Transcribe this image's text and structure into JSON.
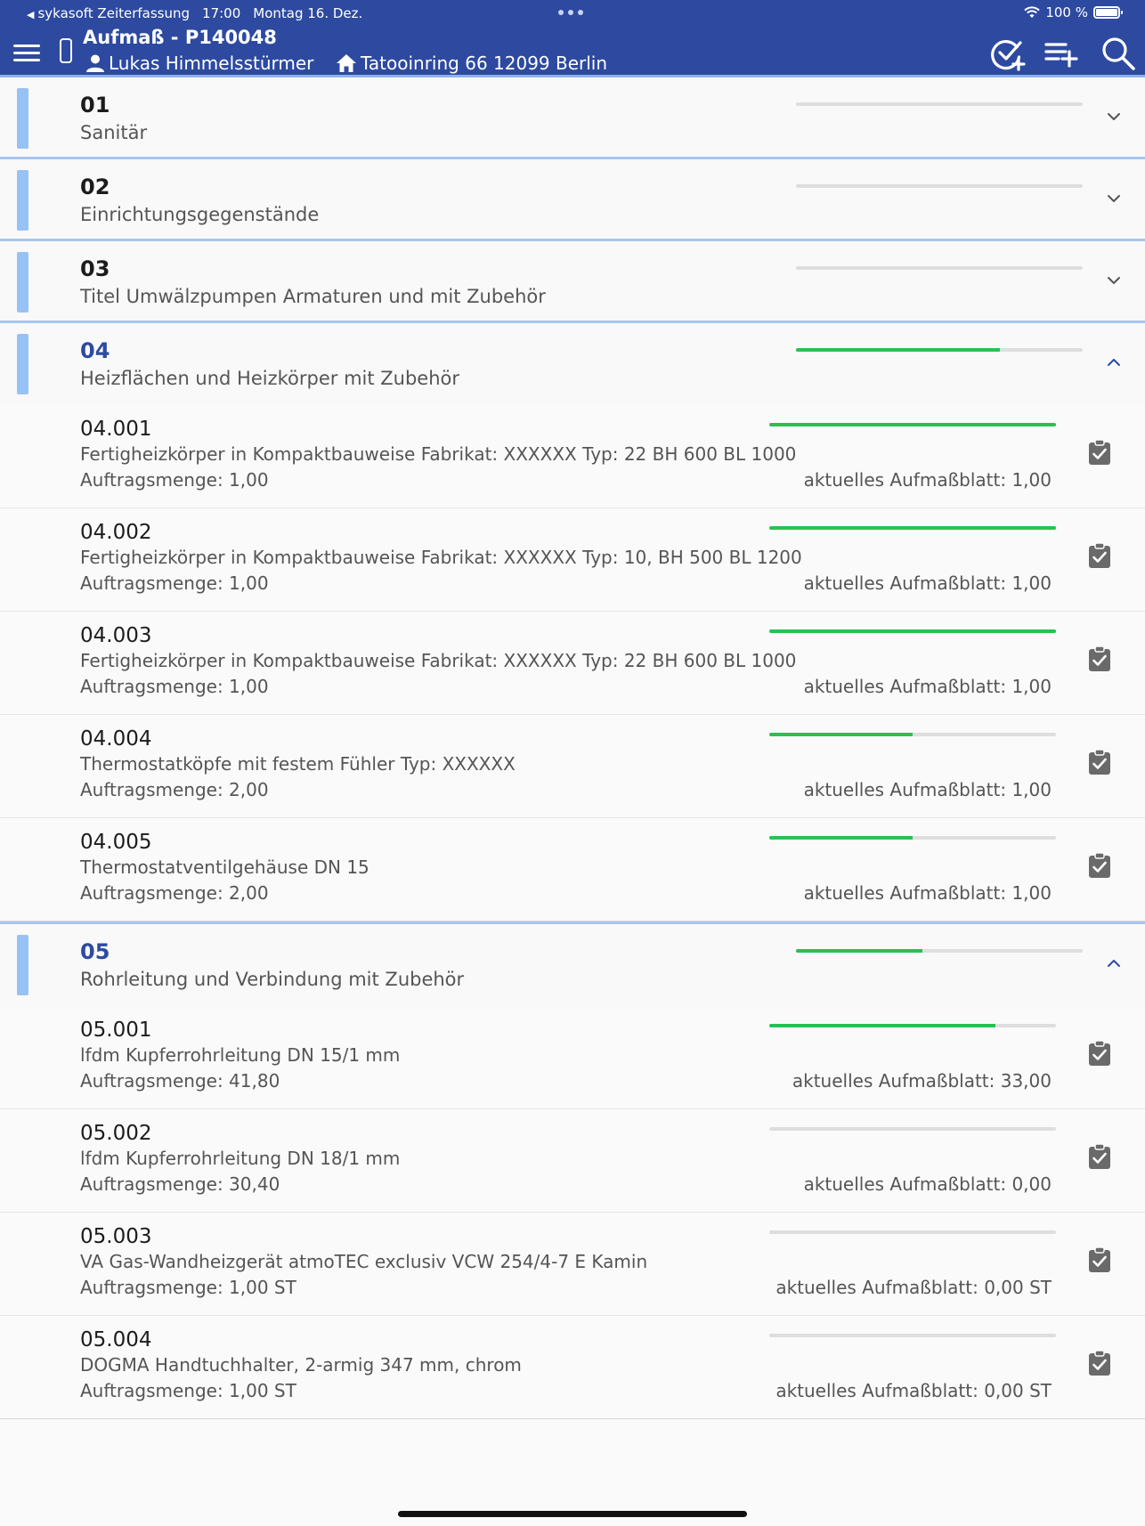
{
  "status_bar": {
    "back_app": "sykasoft Zeiterfassung",
    "time": "17:00",
    "date": "Montag 16. Dez.",
    "battery": "100 %"
  },
  "header": {
    "title": "Aufmaß - P140048",
    "person": "Lukas Himmelsstürmer",
    "address": "Tatooinring 66 12099 Berlin"
  },
  "icons": {
    "menu": "menu-icon",
    "device": "phone-icon",
    "approve": "check-circle-plus-icon",
    "add_list": "playlist-add-icon",
    "search": "search-icon",
    "clipboard": "clipboard-check-icon"
  },
  "colors": {
    "header_bg": "#2d4aa0",
    "progress_fill": "#28c152",
    "accent": "#97c2f5"
  },
  "groups": [
    {
      "number": "01",
      "title": "Sanitär",
      "progress": 0,
      "expanded": false,
      "items": []
    },
    {
      "number": "02",
      "title": "Einrichtungsgegenstände",
      "progress": 0,
      "expanded": false,
      "items": []
    },
    {
      "number": "03",
      "title": "Titel Umwälzpumpen Armaturen und mit Zubehör",
      "progress": 0,
      "expanded": false,
      "items": []
    },
    {
      "number": "04",
      "title": "Heizflächen und Heizkörper mit Zubehör",
      "progress": 0.71,
      "expanded": true,
      "items": [
        {
          "number": "04.001",
          "description": "Fertigheizkörper in Kompaktbauweise Fabrikat: XXXXXX Typ: 22 BH 600 BL 1000",
          "order_qty": "Auftragsmenge: 1,00",
          "current_sheet": "aktuelles Aufmaßblatt: 1,00",
          "progress": 1.0
        },
        {
          "number": "04.002",
          "description": "Fertigheizkörper in Kompaktbauweise Fabrikat: XXXXXX Typ: 10, BH 500 BL 1200",
          "order_qty": "Auftragsmenge: 1,00",
          "current_sheet": "aktuelles Aufmaßblatt: 1,00",
          "progress": 1.0
        },
        {
          "number": "04.003",
          "description": "Fertigheizkörper in Kompaktbauweise Fabrikat: XXXXXX Typ: 22 BH 600 BL 1000",
          "order_qty": "Auftragsmenge: 1,00",
          "current_sheet": "aktuelles Aufmaßblatt: 1,00",
          "progress": 1.0
        },
        {
          "number": "04.004",
          "description": "Thermostatköpfe mit festem Fühler Typ: XXXXXX",
          "order_qty": "Auftragsmenge: 2,00",
          "current_sheet": "aktuelles Aufmaßblatt: 1,00",
          "progress": 0.5
        },
        {
          "number": "04.005",
          "description": "Thermostatventilgehäuse DN 15",
          "order_qty": "Auftragsmenge: 2,00",
          "current_sheet": "aktuelles Aufmaßblatt: 1,00",
          "progress": 0.5
        }
      ]
    },
    {
      "number": "05",
      "title": "Rohrleitung und Verbindung mit Zubehör",
      "progress": 0.44,
      "expanded": true,
      "items": [
        {
          "number": "05.001",
          "description": "lfdm Kupferrohrleitung DN 15/1 mm",
          "order_qty": "Auftragsmenge: 41,80",
          "current_sheet": "aktuelles Aufmaßblatt: 33,00",
          "progress": 0.79
        },
        {
          "number": "05.002",
          "description": "lfdm Kupferrohrleitung DN 18/1 mm",
          "order_qty": "Auftragsmenge: 30,40",
          "current_sheet": "aktuelles Aufmaßblatt: 0,00",
          "progress": 0
        },
        {
          "number": "05.003",
          "description": "VA Gas-Wandheizgerät atmoTEC exclusiv VCW 254/4-7 E Kamin",
          "order_qty": "Auftragsmenge: 1,00 ST",
          "current_sheet": "aktuelles Aufmaßblatt: 0,00 ST",
          "progress": 0
        },
        {
          "number": "05.004",
          "description": "DOGMA Handtuchhalter, 2-armig 347 mm, chrom",
          "order_qty": "Auftragsmenge: 1,00 ST",
          "current_sheet": "aktuelles Aufmaßblatt: 0,00 ST",
          "progress": 0
        }
      ]
    }
  ]
}
